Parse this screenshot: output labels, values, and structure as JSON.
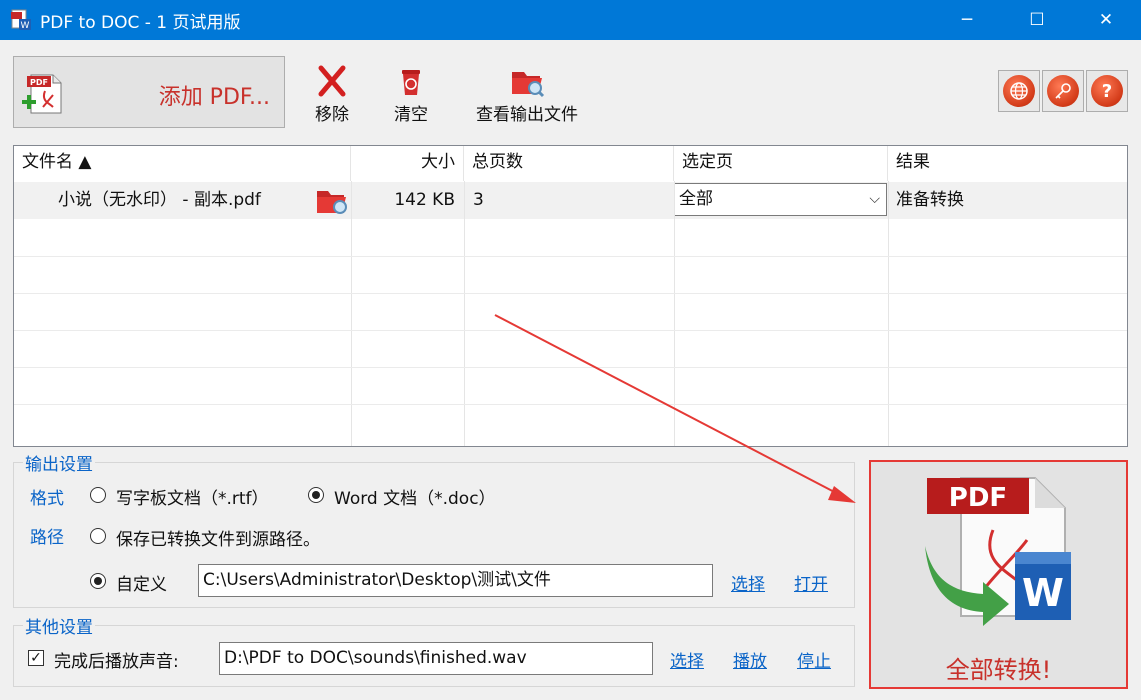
{
  "window": {
    "title": "PDF to DOC - 1 页试用版",
    "minimize_glyph": "─",
    "maximize_glyph": "☐",
    "close_glyph": "✕"
  },
  "toolbar": {
    "add_pdf_label": "添加 PDF...",
    "remove_label": "移除",
    "clear_label": "清空",
    "view_output_label": "查看输出文件",
    "help_glyph": "?"
  },
  "grid": {
    "columns": [
      "文件名 ▲",
      "大小",
      "总页数",
      "选定页",
      "结果"
    ],
    "rows": [
      {
        "file_name": "小说（无水印） - 副本.pdf",
        "size": "142 KB",
        "pages": "3",
        "selected_pages": "全部",
        "result": "准备转换"
      }
    ]
  },
  "output_settings": {
    "legend": "输出设置",
    "format_label": "格式",
    "format_options": [
      "写字板文档（*.rtf）",
      "Word 文档（*.doc）"
    ],
    "format_selected": "Word 文档（*.doc）",
    "path_label": "路径",
    "path_option_source": "保存已转换文件到源路径。",
    "path_option_custom": "自定义",
    "custom_path": "C:\\Users\\Administrator\\Desktop\\测试\\文件",
    "choose_link": "选择",
    "open_link": "打开"
  },
  "other_settings": {
    "legend": "其他设置",
    "play_sound_label": "完成后播放声音:",
    "play_sound_checked": true,
    "sound_path": "D:\\PDF to DOC\\sounds\\finished.wav",
    "choose_link": "选择",
    "play_link": "播放",
    "stop_link": "停止"
  },
  "convert": {
    "label": "全部转换!",
    "icon_text_pdf": "PDF",
    "icon_text_w": "W"
  },
  "colors": {
    "titlebar": "#0078d7",
    "accent_red": "#c8312b",
    "link_blue": "#0a64c8",
    "highlight_border": "#e53935"
  }
}
